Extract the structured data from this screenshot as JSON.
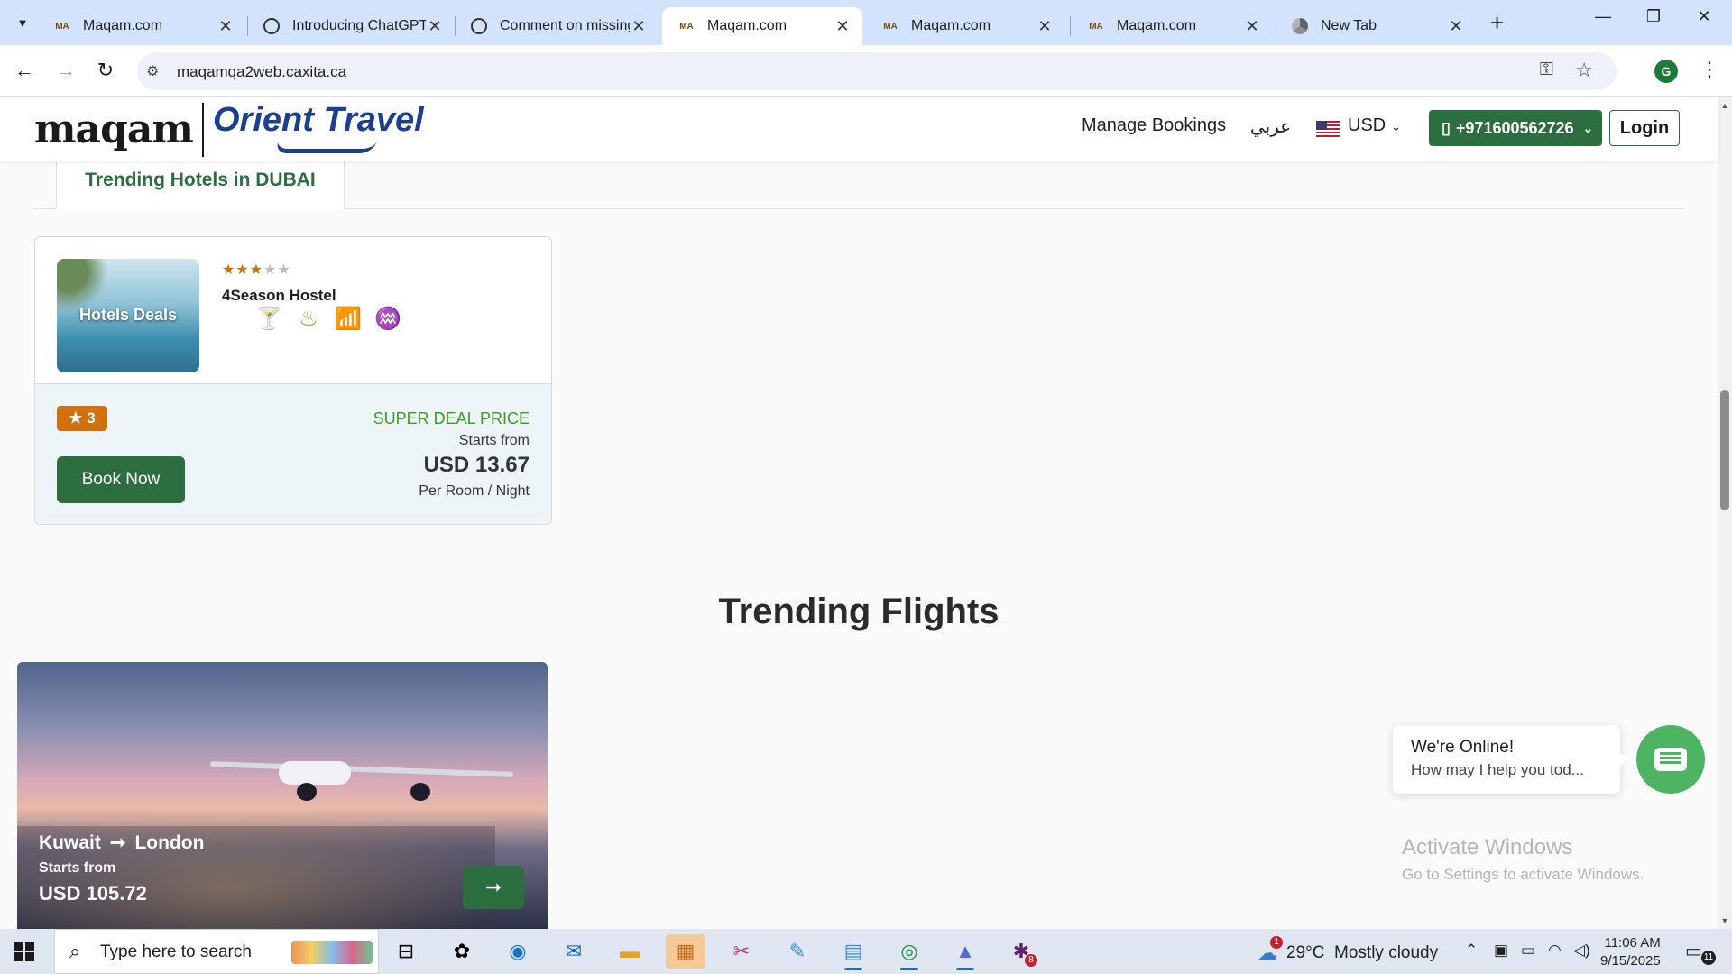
{
  "browser": {
    "tabs": [
      {
        "title": "Maqam.com",
        "icon": "maqam-favicon",
        "active": false
      },
      {
        "title": "Introducing ChatGPT",
        "icon": "chatgpt-favicon",
        "active": false
      },
      {
        "title": "Comment on missing",
        "icon": "chatgpt-favicon",
        "active": false
      },
      {
        "title": "Maqam.com",
        "icon": "maqam-favicon",
        "active": true
      },
      {
        "title": "Maqam.com",
        "icon": "maqam-favicon",
        "active": false
      },
      {
        "title": "Maqam.com",
        "icon": "maqam-favicon",
        "active": false
      },
      {
        "title": "New Tab",
        "icon": "chrome-favicon",
        "active": false
      }
    ],
    "url": "maqamqa2web.caxita.ca",
    "profile_initial": "G"
  },
  "header": {
    "logo_left": "maqam",
    "logo_right": "Orient Travel",
    "manage_bookings": "Manage Bookings",
    "language": "عربي",
    "currency": "USD",
    "phone": "+971600562726",
    "login": "Login"
  },
  "trending_hotels": {
    "tab_label": "Trending Hotels in DUBAI",
    "hotel": {
      "image_text": "Hotels Deals",
      "stars": 3,
      "max_stars": 5,
      "name": "4Season Hostel",
      "amenities": [
        "cocktail-icon",
        "spa-massage-icon",
        "wifi-antenna-icon",
        "sauna-steam-icon"
      ],
      "rating_badge": "3",
      "deal_label": "SUPER DEAL PRICE",
      "starts_from": "Starts from",
      "price": "USD 13.67",
      "per_room": "Per Room / Night",
      "book_button": "Book Now"
    }
  },
  "trending_flights": {
    "title": "Trending Flights",
    "flight": {
      "from": "Kuwait",
      "to": "London",
      "starts_from": "Starts from",
      "price": "USD 105.72"
    }
  },
  "chat": {
    "title": "We're Online!",
    "subtitle": "How may I help you tod..."
  },
  "watermark": {
    "line1": "Activate Windows",
    "line2": "Go to Settings to activate Windows."
  },
  "taskbar": {
    "search_placeholder": "Type here to search",
    "weather_temp": "29°C",
    "weather_desc": "Mostly cloudy",
    "weather_badge": "1",
    "slack_badge": "8",
    "time": "11:06 AM",
    "date": "9/15/2025",
    "notification_count": "11"
  },
  "colors": {
    "brand_green": "#2c6e3f",
    "rating_orange": "#d0700f",
    "deal_green": "#3f9b1f",
    "chat_green": "#4eb363"
  }
}
